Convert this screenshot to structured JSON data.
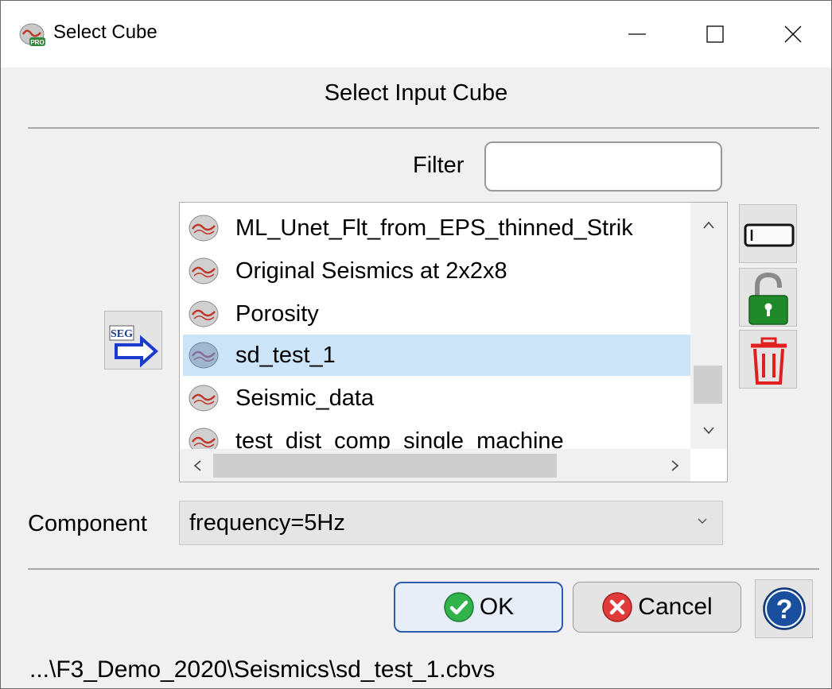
{
  "window": {
    "title": "Select Cube"
  },
  "heading": "Select Input Cube",
  "filter": {
    "label": "Filter",
    "value": ""
  },
  "list": {
    "items": [
      {
        "label": "ML_Unet_Flt_from_EPS_thinned_Strik",
        "selected": false
      },
      {
        "label": "Original Seismics at 2x2x8",
        "selected": false
      },
      {
        "label": "Porosity",
        "selected": false
      },
      {
        "label": "sd_test_1",
        "selected": true
      },
      {
        "label": "Seismic_data",
        "selected": false
      },
      {
        "label": "test_dist_comp_single_machine",
        "selected": false
      }
    ]
  },
  "component": {
    "label": "Component",
    "value": "frequency=5Hz"
  },
  "buttons": {
    "ok": "OK",
    "cancel": "Cancel"
  },
  "path": "...\\F3_Demo_2020\\Seismics\\sd_test_1.cbvs",
  "icons": {
    "app": "opendtect-pro-icon",
    "seg": "segy-import-icon",
    "rename": "rename-icon",
    "lock": "unlock-icon",
    "delete": "trash-icon",
    "help": "help-icon",
    "ok": "check-icon",
    "cancel": "cancel-icon"
  },
  "colors": {
    "selection": "#cce4f7",
    "okBorder": "#2a5db0",
    "lock": "#1a8a1a",
    "delete": "#e02020",
    "help": "#1a4fa0"
  }
}
